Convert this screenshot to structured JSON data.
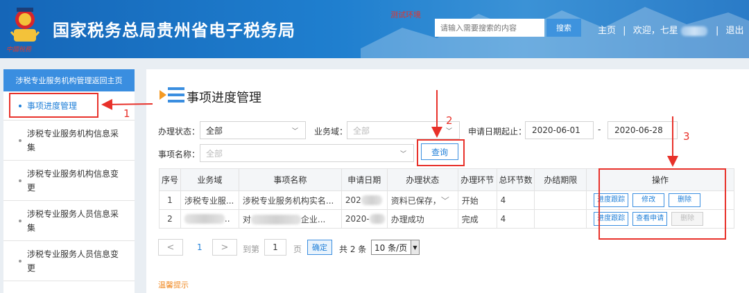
{
  "header": {
    "title": "国家税务总局贵州省电子税务局",
    "emblem_caption": "中國稅務",
    "test_env": "测试环境",
    "search_placeholder": "请输入需要搜索的内容",
    "search_button": "搜索",
    "home_link": "主页",
    "separator": "|",
    "welcome": "欢迎，七星",
    "logout": "退出"
  },
  "sidebar": {
    "back_home": "涉税专业服务机构管理返回主页",
    "items": [
      {
        "label": "事项进度管理",
        "active": true
      },
      {
        "label": "涉税专业服务机构信息采集",
        "active": false
      },
      {
        "label": "涉税专业服务机构信息变更",
        "active": false
      },
      {
        "label": "涉税专业服务人员信息采集",
        "active": false
      },
      {
        "label": "涉税专业服务人员信息变更",
        "active": false
      }
    ]
  },
  "main": {
    "page_title": "事项进度管理",
    "filters": {
      "status_label": "办理状态：",
      "status_value": "全部",
      "domain_label": "业务域：",
      "domain_value": "全部",
      "date_label": "申请日期起止：",
      "date_from": "2020-06-01",
      "date_dash": "-",
      "date_to": "2020-06-28",
      "item_label": "事项名称：",
      "item_value": "全部",
      "query_button": "查询"
    },
    "table": {
      "headers": [
        "序号",
        "业务域",
        "事项名称",
        "申请日期",
        "办理状态",
        "办理环节",
        "总环节数",
        "办结期限",
        "操作"
      ],
      "rows": [
        {
          "no": "1",
          "domain": "涉税专业服...",
          "item": "涉税专业服务机构实名...",
          "date": "202",
          "status": "资料已保存，",
          "stage": "开始",
          "total": "4",
          "deadline": "",
          "actions": [
            {
              "label": "进度跟踪",
              "disabled": false
            },
            {
              "label": "修改",
              "disabled": false
            },
            {
              "label": "删除",
              "disabled": false
            }
          ]
        },
        {
          "no": "2",
          "domain": "..",
          "item_prefix": "对",
          "item_suffix": "企业...",
          "date": "2020-",
          "status": "办理成功",
          "stage": "完成",
          "total": "4",
          "deadline": "",
          "actions": [
            {
              "label": "进度跟踪",
              "disabled": false
            },
            {
              "label": "查看申请",
              "disabled": false
            },
            {
              "label": "删除",
              "disabled": true
            }
          ]
        }
      ]
    },
    "pager": {
      "prev": "<",
      "current_page": "1",
      "next": ">",
      "goto_label": "到第",
      "goto_value": "1",
      "page_unit": "页",
      "confirm": "确定",
      "total": "共 2 条",
      "page_size": "10 条/页"
    },
    "tip_title": "温馨提示"
  },
  "annotations": [
    "1",
    "2",
    "3"
  ],
  "colors": {
    "header_blue": "#1f7fcf",
    "accent_blue": "#1f7fd8",
    "annotation_red": "#e8312a",
    "tip_orange": "#f08a24"
  }
}
